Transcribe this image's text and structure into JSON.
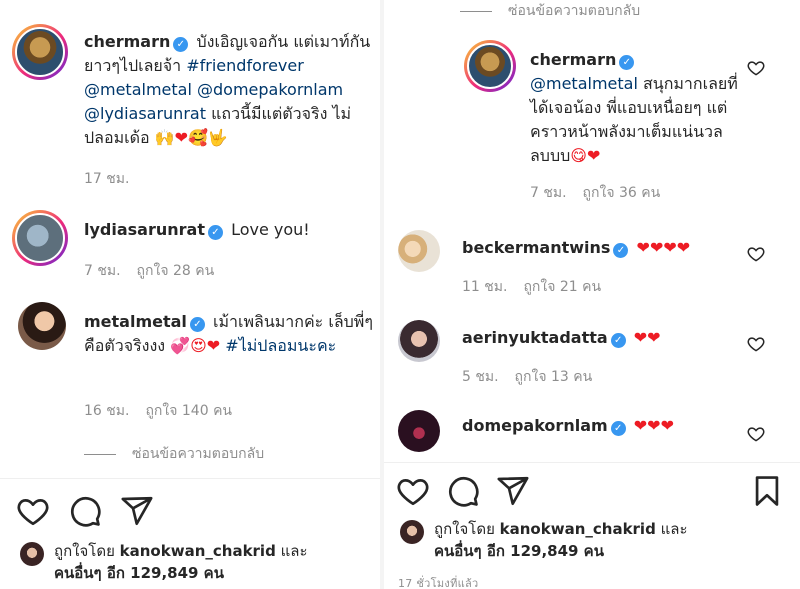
{
  "left": {
    "comments": [
      {
        "username": "chermarn",
        "text_parts": [
          "บังเอิญเจอกัน แต่เมาท์กันยาวๆไปเลยจ้า ",
          "#friendforever",
          " ",
          "@metalmetal",
          " ",
          "@domepakornlam",
          " ",
          "@lydiasarunrat",
          " แถวนี้มีแต่ตัวจริง ไม่ปลอมเด้อ "
        ],
        "emoji": "🙌❤🥰🤟",
        "time": "17 ชม.",
        "likes": ""
      },
      {
        "username": "lydiasarunrat",
        "text_parts": [
          "Love you!"
        ],
        "time": "7 ชม.",
        "likes": "ถูกใจ 28 คน"
      },
      {
        "username": "metalmetal",
        "text_parts": [
          "เม้าเพลินมากค่ะ เล็บพี่ๆคือตัวจริงงง ",
          "#ไม่ปลอมนะคะ"
        ],
        "emoji": "💞😍❤",
        "time": "16 ชม.",
        "likes": "ถูกใจ 140 คน"
      }
    ],
    "hide_replies": "ซ่อนข้อความตอบกลับ",
    "liked_by_prefix": "ถูกใจโดย",
    "liked_by_user": "kanokwan_chakrid",
    "liked_by_and": "และ",
    "liked_by_others": "คนอื่นๆ อีก 129,849 คน"
  },
  "right": {
    "hide_replies": "ซ่อนข้อความตอบกลับ",
    "reply": {
      "username": "chermarn",
      "text_parts": [
        "@metalmetal",
        " สนุกมากเลยที่ได้เจอน้อง พี่แอบเหนื่อยๆ แต่คราวหน้าพลังมาเต็มแน่นวลลบบบ"
      ],
      "emoji": "😋❤",
      "time": "7 ชม.",
      "likes": "ถูกใจ 36 คน"
    },
    "comments": [
      {
        "username": "beckermantwins",
        "emoji": "❤❤❤❤",
        "time": "11 ชม.",
        "likes": "ถูกใจ 21 คน"
      },
      {
        "username": "aerinyuktadatta",
        "emoji": "❤❤",
        "time": "5 ชม.",
        "likes": "ถูกใจ 13 คน"
      },
      {
        "username": "domepakornlam",
        "emoji": "❤❤❤"
      }
    ],
    "liked_by_prefix": "ถูกใจโดย",
    "liked_by_user": "kanokwan_chakrid",
    "liked_by_and": "และ",
    "liked_by_others": "คนอื่นๆ อีก 129,849 คน",
    "timestamp": "17 ชั่วโมงที่แล้ว"
  },
  "icons": {
    "verified": "verified-badge-icon",
    "like": "heart-outline-icon",
    "comment": "comment-bubble-icon",
    "share": "paper-plane-icon",
    "save": "bookmark-icon"
  },
  "colors": {
    "link": "#00376b",
    "verified": "#3897f0",
    "heart": "#ed1c24",
    "muted": "#8e8e8e"
  }
}
